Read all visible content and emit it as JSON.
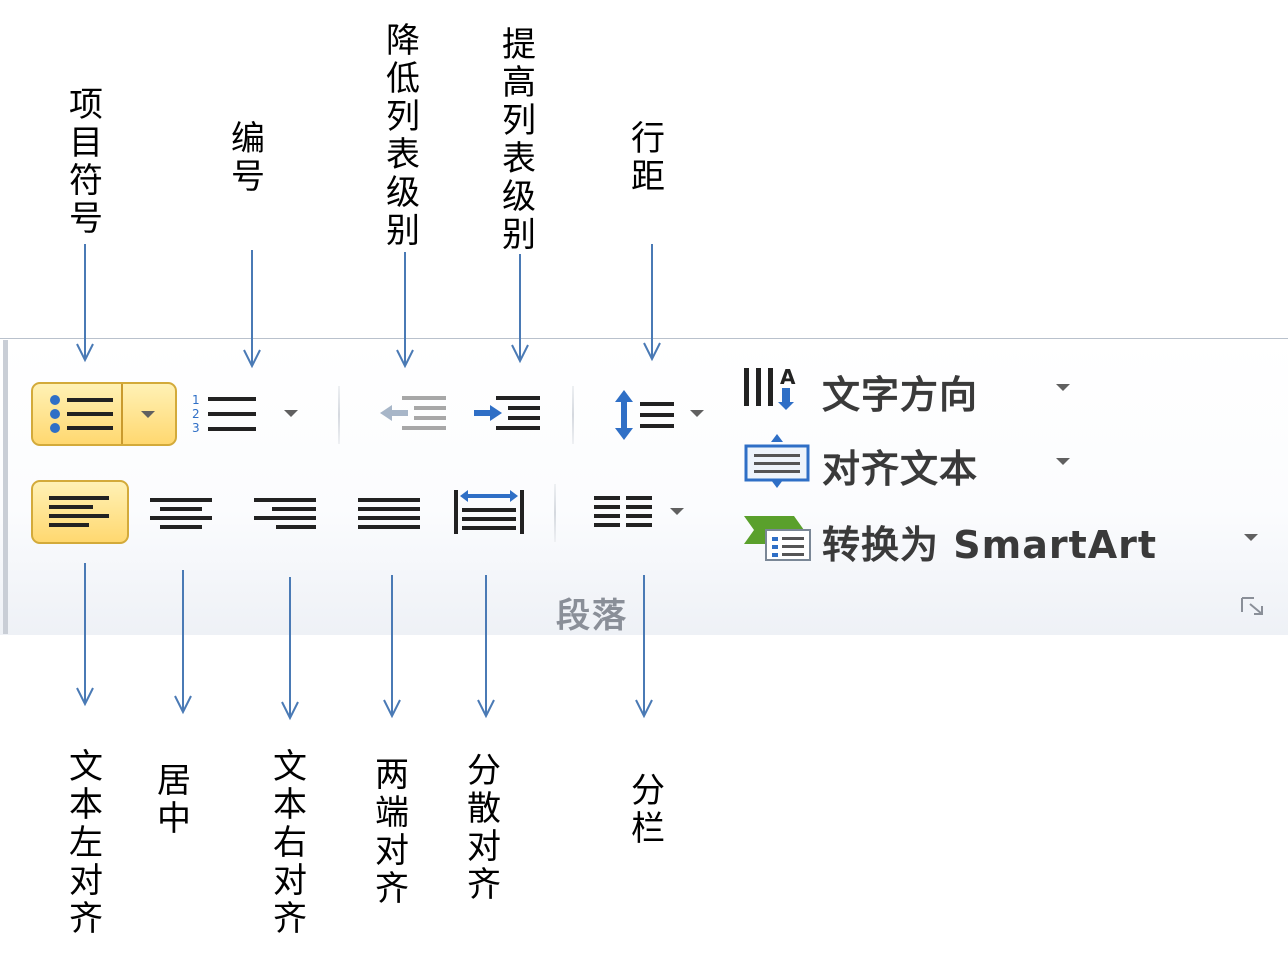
{
  "ribbon": {
    "group_label": "段落",
    "commands": {
      "text_direction": "文字方向",
      "align_text": "对齐文本",
      "convert_smartart": "转换为 SmartArt"
    }
  },
  "annotations": {
    "top": {
      "bullets": "项目符号",
      "numbering": "编号",
      "decrease_indent": "降低列表级别",
      "increase_indent": "提高列表级别",
      "line_spacing": "行距"
    },
    "bottom": {
      "align_left": "文本左对齐",
      "center": "居中",
      "align_right": "文本右对齐",
      "justify": "两端对齐",
      "distributed": "分散对齐",
      "columns": "分栏"
    }
  },
  "icons": {
    "bullets": "bullet-list-icon",
    "numbering": "numbered-list-icon",
    "decrease_indent": "decrease-indent-icon",
    "increase_indent": "increase-indent-icon",
    "line_spacing": "line-spacing-icon",
    "text_direction": "text-direction-icon",
    "align_text": "align-text-icon",
    "smartart": "smartart-icon",
    "align_left": "align-left-icon",
    "center": "align-center-icon",
    "align_right": "align-right-icon",
    "justify": "justify-icon",
    "distributed": "distributed-icon",
    "columns": "columns-icon",
    "dialog_launcher": "dialog-launcher-icon"
  },
  "colors": {
    "annotation_arrow": "#4a7ab5",
    "highlight_fill": "#ffd870",
    "highlight_border": "#d3aa3a",
    "icon_blue": "#2f6fc6"
  }
}
